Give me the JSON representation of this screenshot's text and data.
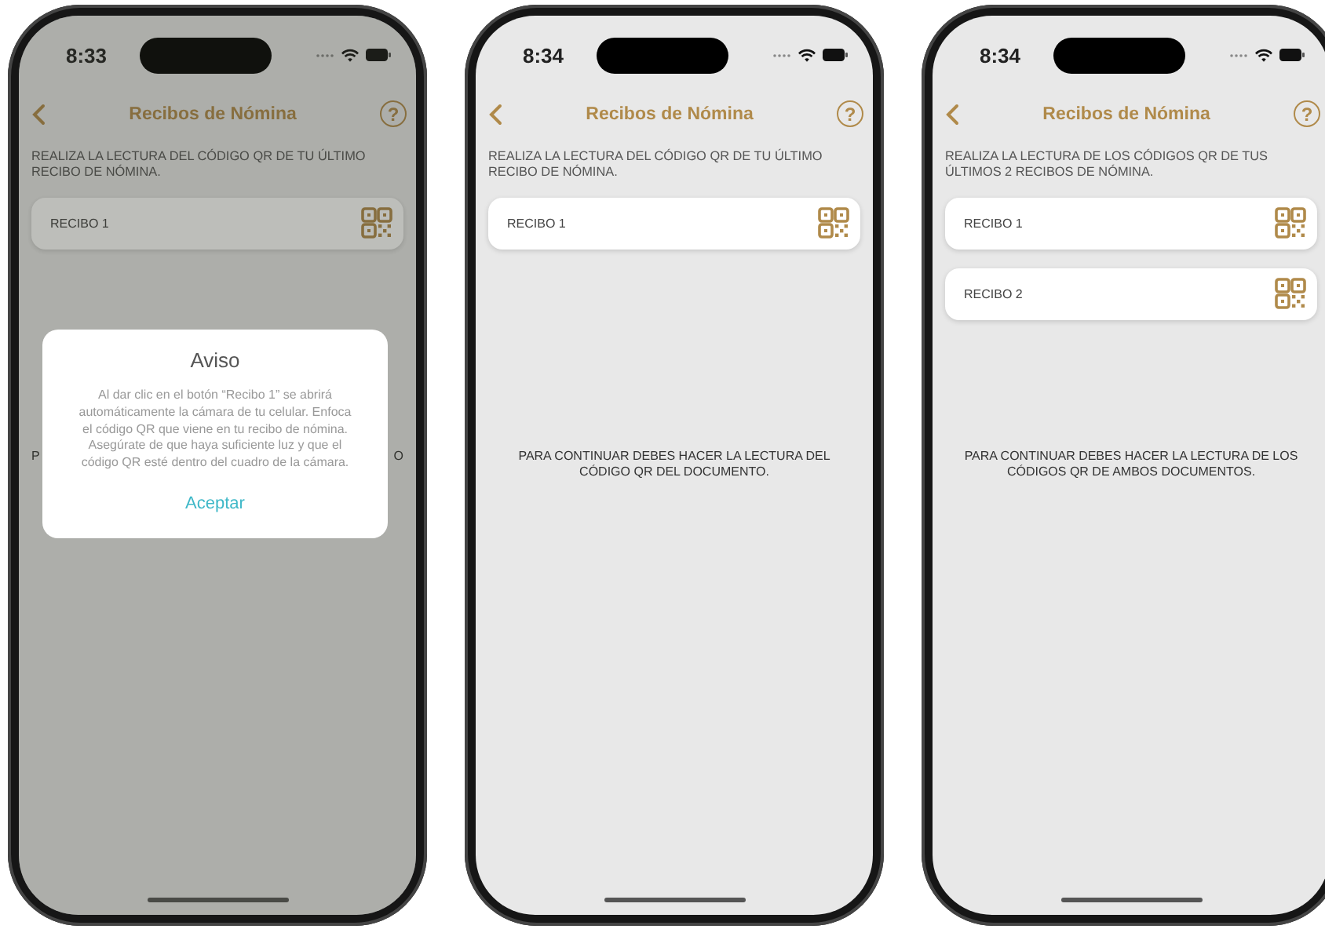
{
  "phones": [
    {
      "status_bar": {
        "time": "8:33"
      },
      "nav": {
        "title": "Recibos de Nómina",
        "help": "?"
      },
      "instruction": "REALIZA LA LECTURA DEL CÓDIGO QR DE TU ÚLTIMO RECIBO DE NÓMINA.",
      "receipts": [
        {
          "label": "RECIBO 1"
        }
      ],
      "footer_fragments": [
        "P",
        "O"
      ],
      "dialog": {
        "title": "Aviso",
        "message": "Al dar clic en el botón “Recibo 1” se abrirá automáticamente la cámara de tu celular. Enfoca el código QR que viene en tu recibo de nómina. Asegúrate de que haya suficiente luz y que el código QR esté dentro del cuadro de la cámara.",
        "button": "Aceptar"
      }
    },
    {
      "status_bar": {
        "time": "8:34"
      },
      "nav": {
        "title": "Recibos de Nómina",
        "help": "?"
      },
      "instruction": "REALIZA LA LECTURA DEL CÓDIGO QR DE TU ÚLTIMO RECIBO DE NÓMINA.",
      "receipts": [
        {
          "label": "RECIBO 1"
        }
      ],
      "footer": "PARA CONTINUAR DEBES HACER LA LECTURA DEL CÓDIGO QR DEL DOCUMENTO."
    },
    {
      "status_bar": {
        "time": "8:34"
      },
      "nav": {
        "title": "Recibos de Nómina",
        "help": "?"
      },
      "instruction": "REALIZA LA LECTURA DE LOS CÓDIGOS QR DE TUS ÚLTIMOS 2 RECIBOS DE NÓMINA.",
      "receipts": [
        {
          "label": "RECIBO 1"
        },
        {
          "label": "RECIBO 2"
        }
      ],
      "footer": "PARA CONTINUAR DEBES HACER LA LECTURA DE LOS CÓDIGOS QR DE AMBOS DOCUMENTOS."
    }
  ]
}
